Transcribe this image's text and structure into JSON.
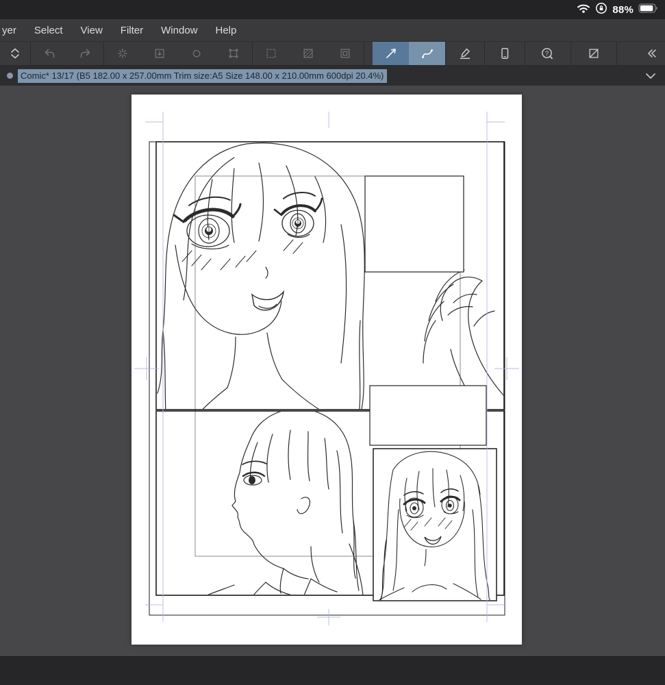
{
  "status_bar": {
    "battery_percent": "88%",
    "icons": [
      "wifi-icon",
      "rotation-lock-icon",
      "battery-icon"
    ]
  },
  "menu_bar": {
    "items": [
      "yer",
      "Select",
      "View",
      "Filter",
      "Window",
      "Help"
    ]
  },
  "toolbar": {
    "buttons": [
      {
        "name": "tool-cycle",
        "icon": "chevron-up-down-icon",
        "state": "normal"
      },
      {
        "name": "undo",
        "icon": "undo-icon",
        "state": "disabled"
      },
      {
        "name": "redo",
        "icon": "redo-icon",
        "state": "disabled"
      },
      {
        "name": "snap-ruler",
        "icon": "burst-icon",
        "state": "disabled"
      },
      {
        "name": "snap-special-ruler",
        "icon": "square-drop-icon",
        "state": "disabled"
      },
      {
        "name": "snap-grid",
        "icon": "lasso-icon",
        "state": "disabled"
      },
      {
        "name": "transform",
        "icon": "transform-frame-icon",
        "state": "disabled"
      },
      {
        "name": "select-area",
        "icon": "dashed-square-icon",
        "state": "disabled"
      },
      {
        "name": "selection-mask",
        "icon": "hatched-square-icon",
        "state": "disabled"
      },
      {
        "name": "selection-launcher",
        "icon": "nested-square-icon",
        "state": "disabled"
      },
      {
        "name": "straight-line-tool",
        "icon": "diagonal-line-icon",
        "state": "selected"
      },
      {
        "name": "curve-tool",
        "icon": "curve-icon",
        "state": "selected-alt"
      },
      {
        "name": "pen-line-tool",
        "icon": "pen-line-icon",
        "state": "normal"
      },
      {
        "name": "companion-device",
        "icon": "phone-icon",
        "state": "normal"
      },
      {
        "name": "help",
        "icon": "help-pen-icon",
        "state": "normal"
      },
      {
        "name": "screen-toggle",
        "icon": "diagonal-square-icon",
        "state": "normal"
      },
      {
        "name": "collapse-toolbar",
        "icon": "double-chevron-left-icon",
        "state": "normal"
      }
    ]
  },
  "document_tab": {
    "label": "Comic* 13/17 (B5 182.00 x 257.00mm Trim size:A5 Size 148.00 x 210.00mm 600dpi 20.4%)"
  },
  "canvas": {
    "page": "manga page with two panels, trim guides and three sketched characters"
  },
  "colors": {
    "selected_tool_bg": "#58799a",
    "selected_tool_bg_light": "#7792ab",
    "tab_highlight": "#7e96ae",
    "guide_blue": "#aeb5e2",
    "workspace_gray": "#474749",
    "chrome_gray": "#3a3a3c"
  }
}
